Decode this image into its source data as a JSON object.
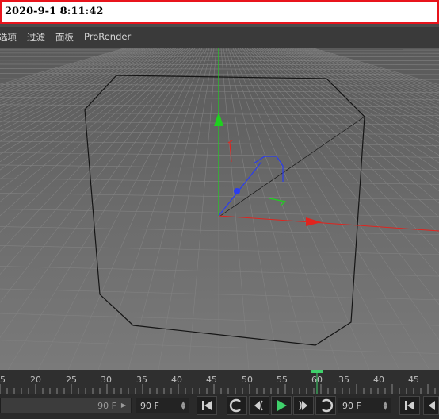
{
  "timestamp": "2020-9-1 8:11:42",
  "menu": {
    "items": [
      "选项",
      "过滤",
      "面板",
      "ProRender"
    ]
  },
  "timeline": {
    "ruler_labels": [
      "5",
      "20",
      "25",
      "30",
      "35",
      "40",
      "45",
      "50",
      "55",
      "60",
      "35",
      "40",
      "45"
    ],
    "end_frame_left": "90 F",
    "end_frame_right": "90 F",
    "end_frame_far": "90 F"
  },
  "colors": {
    "x_axis": "#e0241e",
    "y_axis": "#1fd01f",
    "z_axis": "#2a3cf0",
    "play_active": "#3fd16b"
  },
  "icons": {
    "first_frame": "skip-to-start-icon",
    "prev_key": "previous-key-icon",
    "step_back": "step-back-icon",
    "play": "play-icon",
    "step_forward": "step-forward-icon",
    "next_key": "next-key-icon",
    "last_frame": "skip-to-end-icon"
  }
}
